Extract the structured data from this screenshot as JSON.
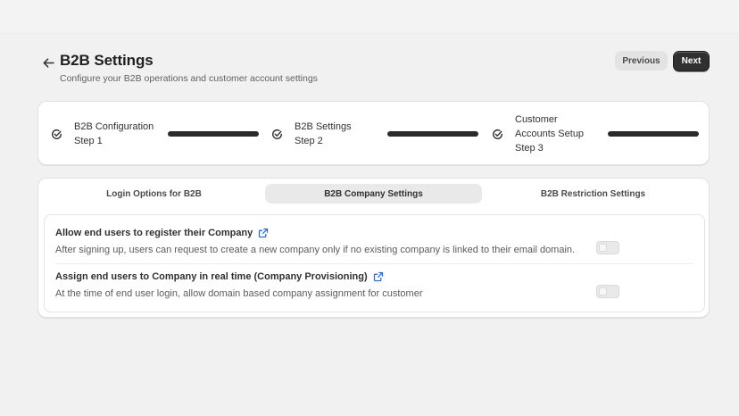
{
  "header": {
    "title": "B2B Settings",
    "subtitle": "Configure your B2B operations and customer account settings",
    "back_icon": "arrow-left-icon",
    "previous_label": "Previous",
    "next_label": "Next"
  },
  "steps": [
    {
      "title": "B2B Configuration",
      "step": "Step 1",
      "progress": 1.0
    },
    {
      "title": "B2B Settings",
      "step": "Step 2",
      "progress": 1.0
    },
    {
      "title_line1": "Customer",
      "title_line2": "Accounts Setup",
      "step": "Step 3",
      "progress": 1.0
    }
  ],
  "tabs": [
    {
      "label": "Login Options for B2B",
      "active": false
    },
    {
      "label": "B2B Company Settings",
      "active": true
    },
    {
      "label": "B2B Restriction Settings",
      "active": false
    }
  ],
  "settings": [
    {
      "title": "Allow end users to register their Company",
      "description": "After signing up, users can request to create a new company only if no existing company is linked to their email domain.",
      "enabled": false
    },
    {
      "title": "Assign end users to Company in real time (Company Provisioning)",
      "description": "At the time of end user login, allow domain based company assignment for customer",
      "enabled": false
    }
  ],
  "colors": {
    "background": "#f1f1f1",
    "primary_button": "#303030",
    "progress_bar": "#2b2b2b",
    "link_icon": "#2c6ecb"
  }
}
